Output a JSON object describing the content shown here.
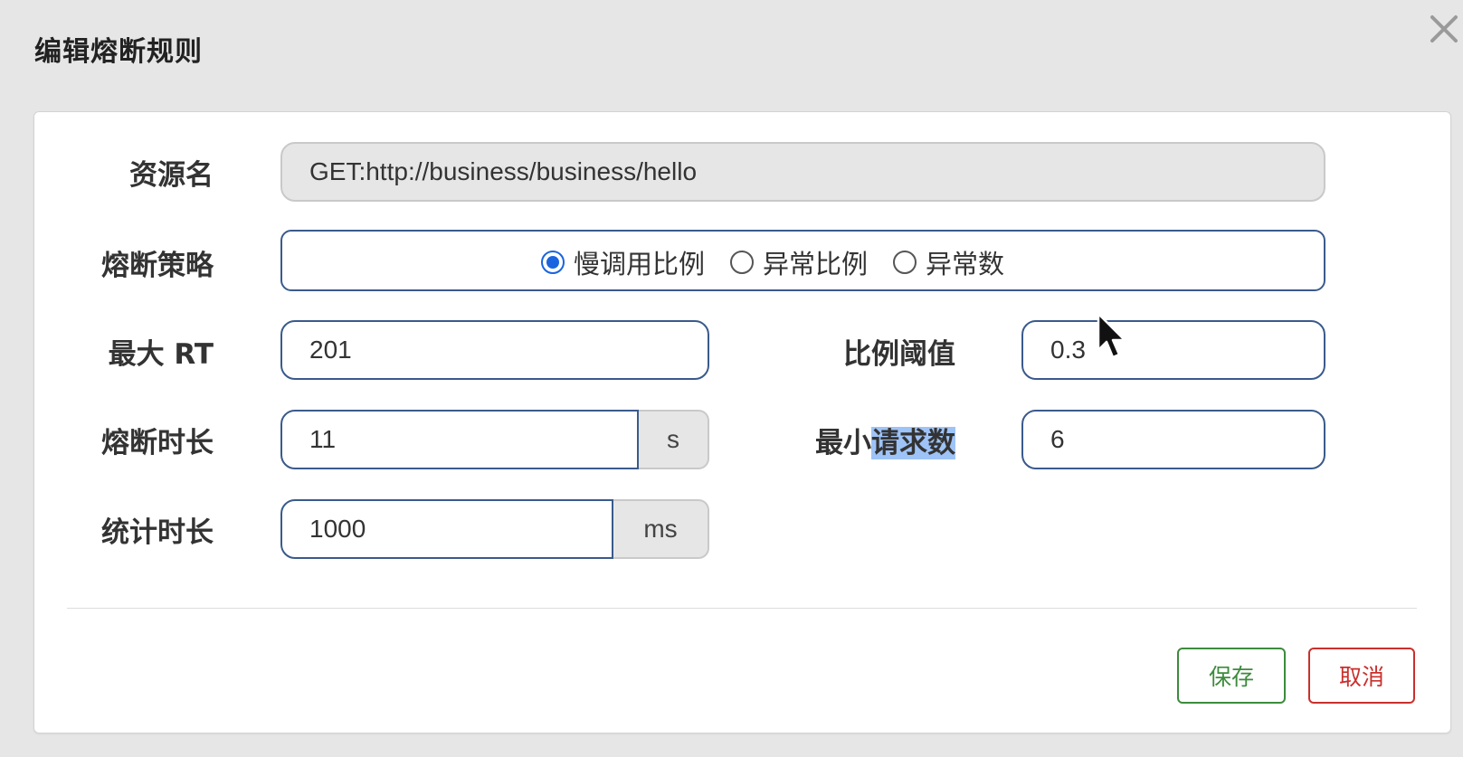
{
  "dialog": {
    "title": "编辑熔断规则",
    "close_symbol": "✕"
  },
  "form": {
    "resource": {
      "label": "资源名",
      "value": "GET:http://business/business/hello"
    },
    "strategy": {
      "label": "熔断策略",
      "options": [
        "慢调用比例",
        "异常比例",
        "异常数"
      ],
      "selected": "慢调用比例"
    },
    "max_rt": {
      "label": "最大 RT",
      "value": "201"
    },
    "ratio_threshold": {
      "label": "比例阈值",
      "value": "0.3"
    },
    "break_duration": {
      "label": "熔断时长",
      "value": "11",
      "unit": "s"
    },
    "min_request": {
      "label_part1": "最小",
      "label_part2": "请求数",
      "value": "6"
    },
    "stat_duration": {
      "label": "统计时长",
      "value": "1000",
      "unit": "ms"
    }
  },
  "buttons": {
    "save": "保存",
    "cancel": "取消"
  },
  "colors": {
    "input_border": "#3a5a8c",
    "radio_checked": "#1a64e0",
    "save": "#3d8b3d",
    "cancel": "#c9302c",
    "selection_highlight": "#9ec3f7"
  }
}
